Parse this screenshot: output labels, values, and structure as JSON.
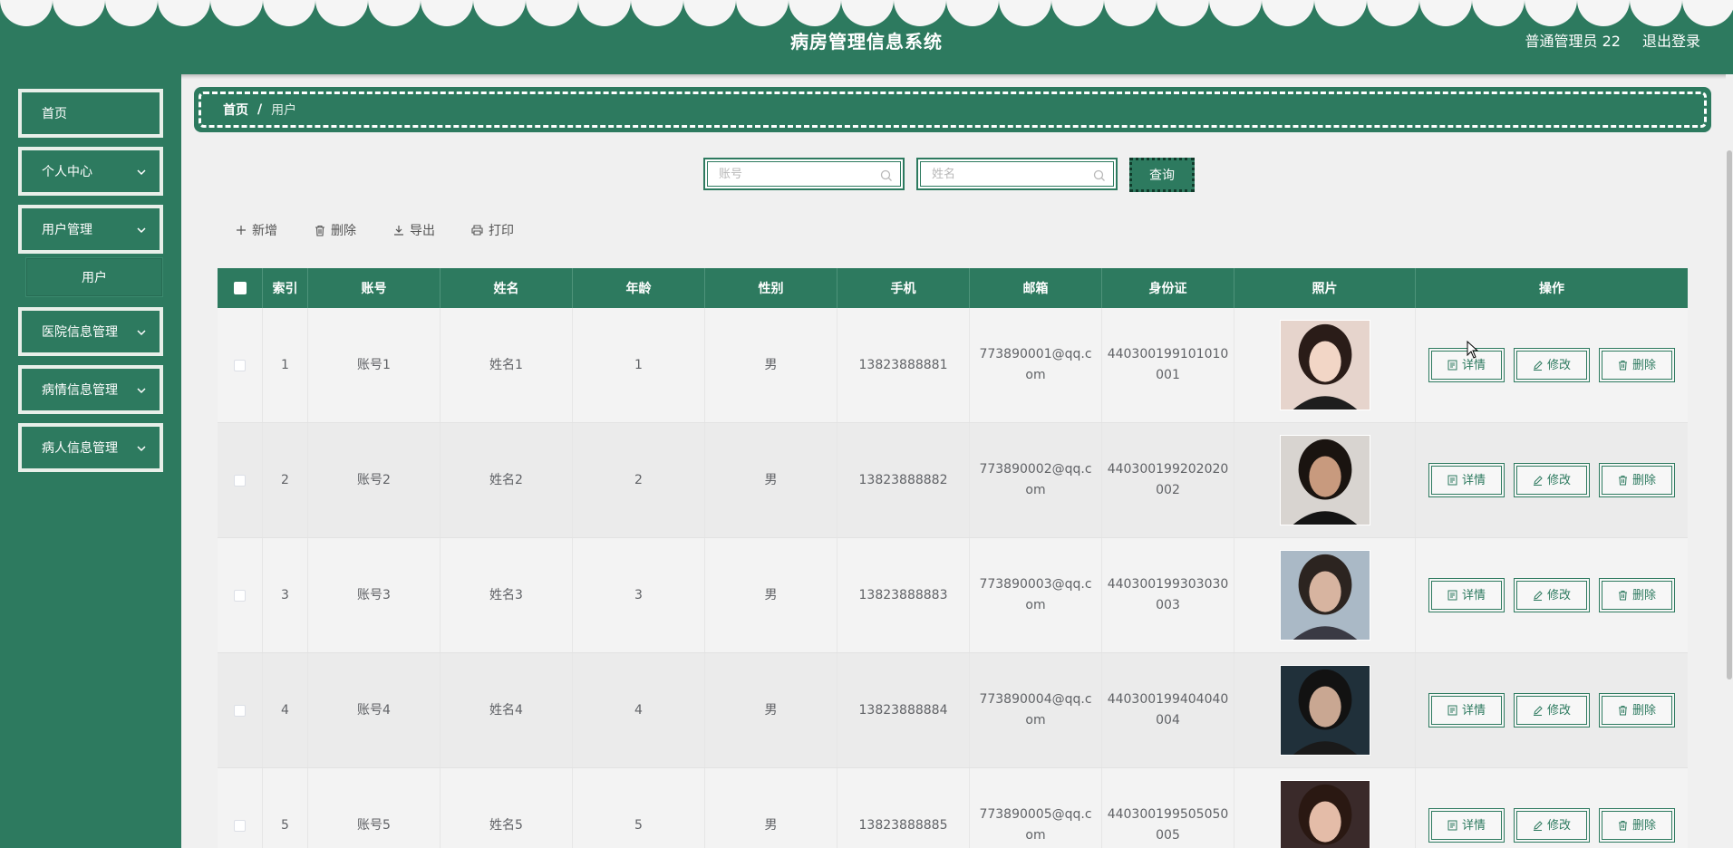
{
  "header": {
    "title": "病房管理信息系统",
    "user": "普通管理员 22",
    "logout": "退出登录"
  },
  "sidebar": {
    "items": [
      {
        "label": "首页",
        "icon": "none"
      },
      {
        "label": "个人中心",
        "icon": "chevron-down-icon"
      },
      {
        "label": "用户管理",
        "icon": "chevron-down-icon"
      },
      {
        "label": "医院信息管理",
        "icon": "chevron-down-icon"
      },
      {
        "label": "病情信息管理",
        "icon": "chevron-down-icon"
      },
      {
        "label": "病人信息管理",
        "icon": "chevron-down-icon"
      }
    ],
    "sub_item": "用户"
  },
  "breadcrumb": {
    "home": "首页",
    "separator": "/",
    "current": "用户"
  },
  "search": {
    "account_placeholder": "账号",
    "account_value": "",
    "name_placeholder": "姓名",
    "name_value": "",
    "query_label": "查询"
  },
  "toolbar": {
    "add": "新增",
    "delete": "删除",
    "export": "导出",
    "print": "打印"
  },
  "table": {
    "headers": [
      "索引",
      "账号",
      "姓名",
      "年龄",
      "性别",
      "手机",
      "邮箱",
      "身份证",
      "照片",
      "操作"
    ],
    "rows": [
      {
        "index": "1",
        "account": "账号1",
        "name": "姓名1",
        "age": "1",
        "gender": "男",
        "phone": "13823888881",
        "email_a": "773890001@qq.c",
        "email_b": "om",
        "id_a": "440300199101010",
        "id_b": "001"
      },
      {
        "index": "2",
        "account": "账号2",
        "name": "姓名2",
        "age": "2",
        "gender": "男",
        "phone": "13823888882",
        "email_a": "773890002@qq.c",
        "email_b": "om",
        "id_a": "440300199202020",
        "id_b": "002"
      },
      {
        "index": "3",
        "account": "账号3",
        "name": "姓名3",
        "age": "3",
        "gender": "男",
        "phone": "13823888883",
        "email_a": "773890003@qq.c",
        "email_b": "om",
        "id_a": "440300199303030",
        "id_b": "003"
      },
      {
        "index": "4",
        "account": "账号4",
        "name": "姓名4",
        "age": "4",
        "gender": "男",
        "phone": "13823888884",
        "email_a": "773890004@qq.c",
        "email_b": "om",
        "id_a": "440300199404040",
        "id_b": "004"
      },
      {
        "index": "5",
        "account": "账号5",
        "name": "姓名5",
        "age": "5",
        "gender": "男",
        "phone": "13823888885",
        "email_a": "773890005@qq.c",
        "email_b": "om",
        "id_a": "440300199505050",
        "id_b": "005"
      }
    ],
    "actions": {
      "detail": "详情",
      "edit": "修改",
      "delete": "删除"
    }
  },
  "colors": {
    "primary": "#2d7a5f",
    "background": "#f0f0f0",
    "scallop": "#f5f5f5"
  }
}
